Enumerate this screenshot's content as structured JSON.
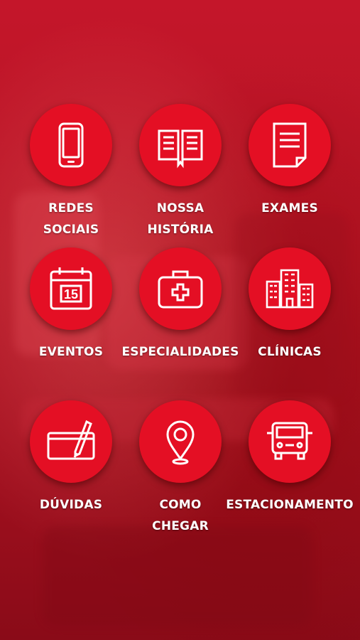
{
  "tiles": [
    {
      "line1": "REDES",
      "line2": "SOCIAIS",
      "icon": "smartphone-icon"
    },
    {
      "line1": "NOSSA",
      "line2": "HISTÓRIA",
      "icon": "book-icon"
    },
    {
      "line1": "EXAMES",
      "line2": "",
      "icon": "document-icon"
    },
    {
      "line1": "EVENTOS",
      "line2": "",
      "icon": "calendar-icon",
      "calendar_day": "15"
    },
    {
      "line1": "ESPECIALIDADES",
      "line2": "",
      "icon": "medical-kit-icon"
    },
    {
      "line1": "CLÍNICAS",
      "line2": "",
      "icon": "buildings-icon"
    },
    {
      "line1": "DÚVIDAS",
      "line2": "",
      "icon": "pen-tablet-icon"
    },
    {
      "line1": "COMO",
      "line2": "CHEGAR",
      "icon": "map-pin-icon"
    },
    {
      "line1": "ESTACIONAMENTO",
      "line2": "",
      "icon": "vehicle-icon"
    }
  ],
  "colors": {
    "background": "#b01322",
    "circle": "#e40f24",
    "text": "#ffffff"
  }
}
